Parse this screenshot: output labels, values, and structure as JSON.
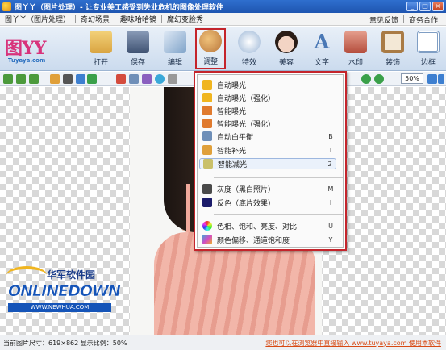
{
  "window": {
    "title": "图丫丫（图片处理）- 让专业美工感受到失业危机的图像处理软件"
  },
  "menubar": {
    "left": [
      "图丫丫（图片处理）",
      "奇幻场景",
      "趣味哈哈镜",
      "魔幻变脸秀"
    ],
    "right": [
      "意见反馈",
      "商务合作"
    ]
  },
  "logo": {
    "text": "图YY",
    "subtext": "Tuyaya.com"
  },
  "toolbar": {
    "buttons": [
      {
        "label": "打开",
        "icon": "folder-open-icon",
        "color": "#d9a441"
      },
      {
        "label": "保存",
        "icon": "floppy-disk-icon",
        "color": "#5b6f8f"
      },
      {
        "label": "编辑",
        "icon": "pencil-edit-icon",
        "color": "#7fa3c9"
      },
      {
        "label": "调整",
        "icon": "palette-icon",
        "color": "#b8753a"
      },
      {
        "label": "特效",
        "icon": "sparkle-lens-icon",
        "color": "#9bb6d6"
      },
      {
        "label": "美容",
        "icon": "face-icon",
        "color": "#e2b5a3"
      },
      {
        "label": "文字",
        "icon": "letter-a-icon",
        "color": "#4a78b5"
      },
      {
        "label": "水印",
        "icon": "stamp-icon",
        "color": "#b44c3c"
      },
      {
        "label": "装饰",
        "icon": "frame-decoration-icon",
        "color": "#a97b45"
      },
      {
        "label": "边框",
        "icon": "border-icon",
        "color": "#7f9ec4"
      }
    ]
  },
  "zoom": {
    "value": "50%"
  },
  "menu": {
    "items": [
      {
        "label": "自动曝光",
        "shortcut": "",
        "icon": "auto-exposure-icon",
        "color": "#f0b51f"
      },
      {
        "label": "自动曝光（强化）",
        "shortcut": "",
        "icon": "auto-exposure-plus-icon",
        "color": "#f0b51f"
      },
      {
        "label": "智能曝光",
        "shortcut": "",
        "icon": "smart-exposure-icon",
        "color": "#e07a2e"
      },
      {
        "label": "智能曝光（强化）",
        "shortcut": "",
        "icon": "smart-exposure-plus-icon",
        "color": "#e07a2e"
      },
      {
        "label": "自动白平衡",
        "shortcut": "B",
        "icon": "white-balance-icon",
        "color": "#6f8fb8"
      },
      {
        "label": "智能补光",
        "shortcut": "I",
        "icon": "fill-light-icon",
        "color": "#e0a03a"
      },
      {
        "label": "智能减光",
        "shortcut": "2",
        "icon": "reduce-light-icon",
        "color": "#c9c06a"
      },
      {
        "label": "灰度（黑白照片）",
        "shortcut": "M",
        "icon": "grayscale-icon",
        "color": "#4a4a4a"
      },
      {
        "label": "反色（底片效果）",
        "shortcut": "I",
        "icon": "invert-color-icon",
        "color": "#1b1b6a"
      },
      {
        "label": "色相、饱和、亮度、对比",
        "shortcut": "U",
        "icon": "color-wheel-icon",
        "color": "#d44bc4"
      },
      {
        "label": "颜色偏移、通道饱和度",
        "shortcut": "Y",
        "icon": "color-shift-icon",
        "color": "#3aa8d8"
      }
    ]
  },
  "watermark": {
    "cn": "华军软件园",
    "en": "ONLINEDOWN",
    "url": "WWW.NEWHUA.COM"
  },
  "status": {
    "left": "当前图片尺寸：619×862   显示比例：50%",
    "right": "您也可以在浏览器中直接输入 www.tuyaya.com 使用本软件"
  }
}
